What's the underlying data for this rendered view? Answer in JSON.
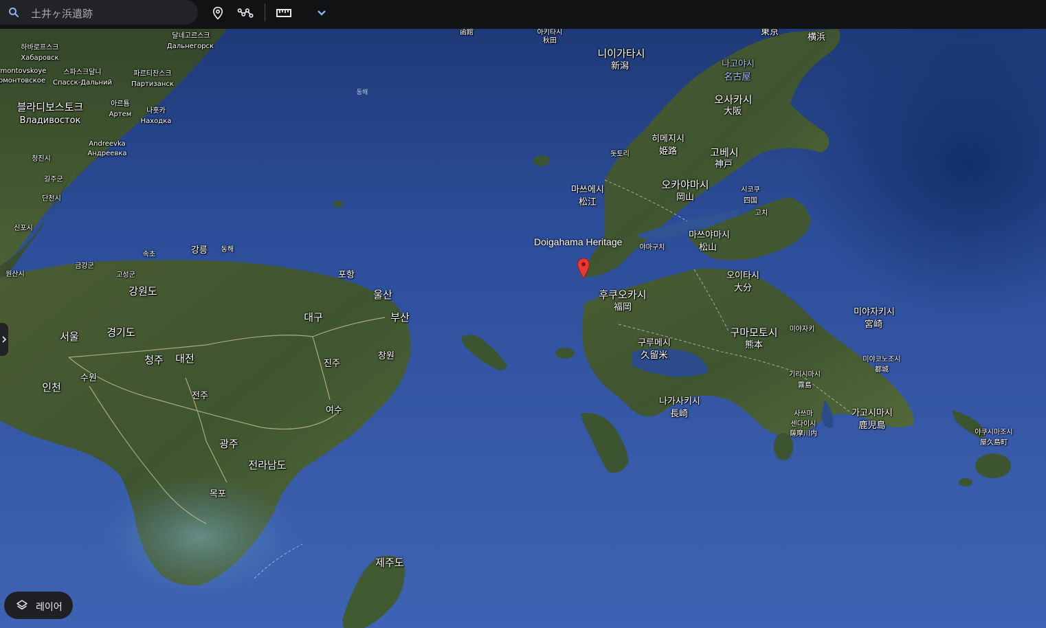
{
  "search": {
    "value": "土井ヶ浜遺跡"
  },
  "toolbar": {
    "icons": [
      "place-pin-icon",
      "path-icon",
      "ruler-icon",
      "chevron-down-icon"
    ]
  },
  "layers_button": {
    "label": "레이어"
  },
  "poi": {
    "title": "Doigahama Heritage"
  },
  "labels": {
    "hakodate": "函館",
    "akita_ko": "아키타시",
    "akita_ja": "秋田",
    "tokyo": "東京",
    "yokohama": "横浜",
    "niigata_ko": "니이가타시",
    "niigata_ja": "新潟",
    "nagoya_ko": "나고야시",
    "nagoya_ja": "名古屋",
    "osaka_ko": "오사카시",
    "osaka_ja": "大阪",
    "himeji_ko": "히메지시",
    "himeji_ja": "姫路",
    "kobe_ko": "고베시",
    "kobe_ja": "神戸",
    "tottori": "돗토리",
    "okayama_ko": "오카야마시",
    "okayama_ja": "岡山",
    "matsue_ko": "마쓰에시",
    "matsue_ja": "松江",
    "shikoku_ko": "시코쿠",
    "shikoku_ja": "四国",
    "kochi": "고치",
    "matsuyama_ko": "마쓰야마시",
    "matsuyama_ja": "松山",
    "yamaguchi": "야마구치",
    "oita_ko": "오이타시",
    "oita_ja": "大分",
    "fukuoka_ko": "후쿠오카시",
    "fukuoka_ja": "福岡",
    "miyazaki_ko": "미야자키시",
    "miyazaki_ja": "宮崎",
    "kurume_ko": "구루메시",
    "kurume_ja": "久留米",
    "kumamoto_ko": "구마모토시",
    "kumamoto_ja": "熊本",
    "miyazaki_small": "미야자키",
    "miyakonojo_ko": "미야코노조시",
    "miyakonojo_ja": "都城",
    "kirishima_ko": "기리시마시",
    "kirishima_ja": "霧島",
    "nagasaki_ko": "나가사키시",
    "nagasaki_ja": "長崎",
    "satsuma_ko": "사쓰마",
    "satsumasendai_ko": "센다이시",
    "satsumasendai_ja": "薩摩川内",
    "kagoshima_ko": "가고시마시",
    "kagoshima_ja": "鹿児島",
    "yakushima_ko": "야쿠시마조시",
    "yakushima_ja": "屋久島町",
    "khabarovsk_ko": "하바로프스크",
    "khabarovsk_ru": "Хабаровск",
    "dalnegorsk_ko": "달네고르스크",
    "dalnegorsk_ru": "Дальнегорск",
    "kirovsky_ko": "rmontovskoye",
    "kirovsky_ru": "рмонтовское",
    "spassk_ko": "스파스크달니",
    "spassk_ru": "Спасск-Дальний",
    "partizansk_ko": "파르티잔스크",
    "partizansk_ru": "Партизанск",
    "vladivostok_ko": "블라디보스토크",
    "vladivostok_ru": "Владивосток",
    "artem_ko": "아르툠",
    "artem_ru": "Артем",
    "nakhodka_ko": "나홋카",
    "nakhodka_ru": "Находка",
    "andreevka_en": "Andreevka",
    "andreevka_ru": "Андреевка",
    "east_sea": "동해",
    "chongjin": "청진시",
    "kilju": "길주군",
    "tanchon": "단천시",
    "sinpo": "신포시",
    "wonsan": "원산시",
    "kumgang": "금강군",
    "sokcho": "속초",
    "gangneung": "강릉",
    "donghae": "동해",
    "goseong": "고성군",
    "gangwon": "강원도",
    "pohang": "포항",
    "ulsan": "울산",
    "daegu": "대구",
    "busan": "부산",
    "seoul": "서울",
    "gyeonggi": "경기도",
    "cheongju": "청주",
    "daejeon": "대전",
    "changwon": "창원",
    "jinju": "진주",
    "incheon": "인천",
    "suwon": "수원",
    "jeonju": "전주",
    "yeosu": "여수",
    "gwangju": "광주",
    "jeollanam": "전라남도",
    "mokpo": "목포",
    "jeju": "제주도"
  }
}
